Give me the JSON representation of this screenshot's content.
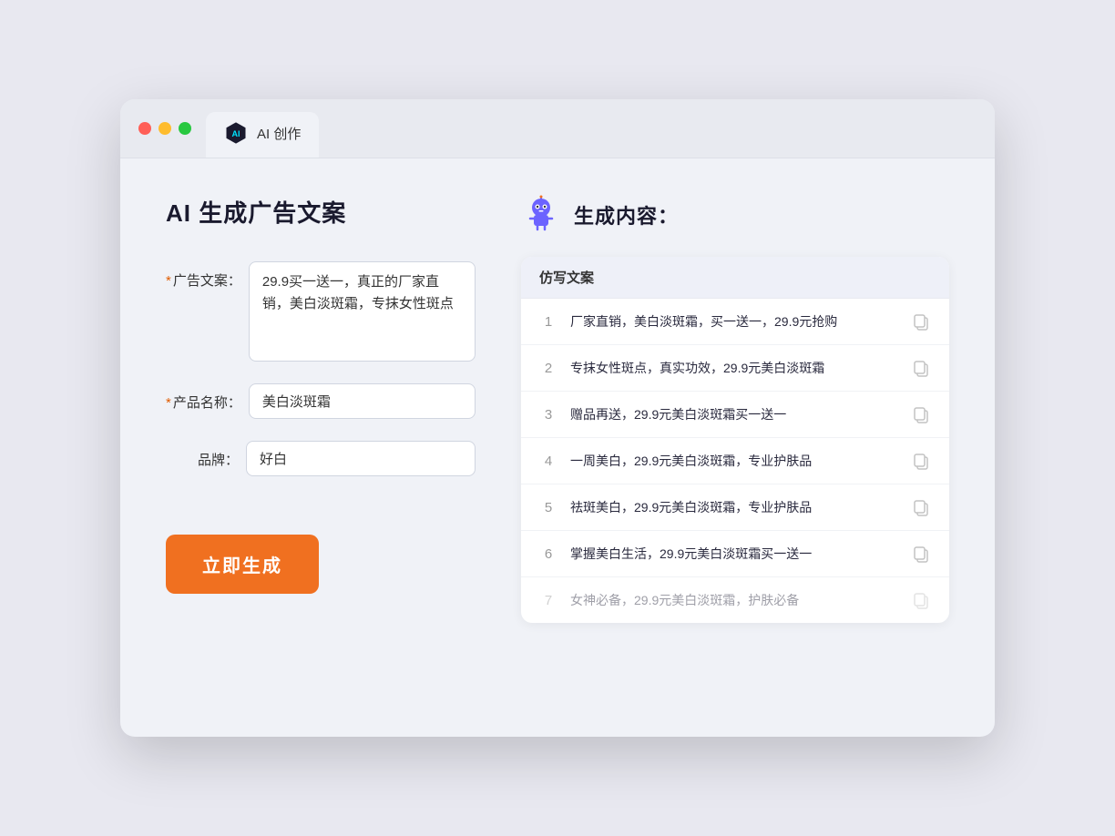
{
  "browser": {
    "tab_label": "AI 创作"
  },
  "left_panel": {
    "title": "AI 生成广告文案",
    "fields": [
      {
        "label": "广告文案：",
        "required": true,
        "type": "textarea",
        "value": "29.9买一送一，真正的厂家直销，美白淡斑霜，专抹女性斑点",
        "name": "ad-copy-input"
      },
      {
        "label": "产品名称：",
        "required": true,
        "type": "input",
        "value": "美白淡斑霜",
        "name": "product-name-input"
      },
      {
        "label": "品牌：",
        "required": false,
        "type": "input",
        "value": "好白",
        "name": "brand-input"
      }
    ],
    "button_label": "立即生成"
  },
  "right_panel": {
    "title": "生成内容：",
    "table_header": "仿写文案",
    "results": [
      {
        "num": 1,
        "text": "厂家直销，美白淡斑霜，买一送一，29.9元抢购",
        "faded": false
      },
      {
        "num": 2,
        "text": "专抹女性斑点，真实功效，29.9元美白淡斑霜",
        "faded": false
      },
      {
        "num": 3,
        "text": "赠品再送，29.9元美白淡斑霜买一送一",
        "faded": false
      },
      {
        "num": 4,
        "text": "一周美白，29.9元美白淡斑霜，专业护肤品",
        "faded": false
      },
      {
        "num": 5,
        "text": "祛斑美白，29.9元美白淡斑霜，专业护肤品",
        "faded": false
      },
      {
        "num": 6,
        "text": "掌握美白生活，29.9元美白淡斑霜买一送一",
        "faded": false
      },
      {
        "num": 7,
        "text": "女神必备，29.9元美白淡斑霜，护肤必备",
        "faded": true
      }
    ]
  }
}
